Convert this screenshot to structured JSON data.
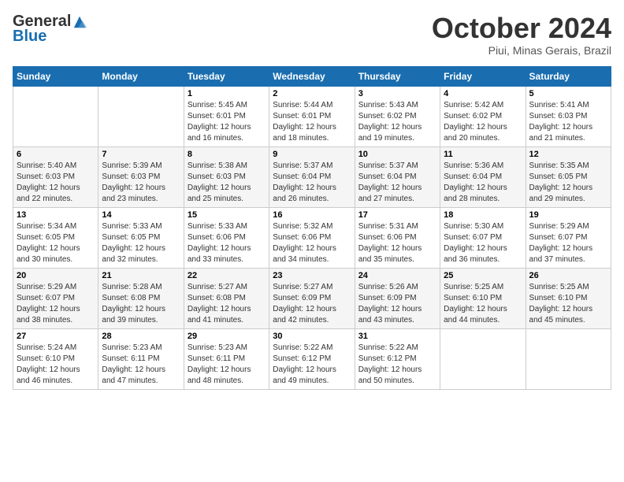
{
  "logo": {
    "general": "General",
    "blue": "Blue"
  },
  "title": "October 2024",
  "location": "Piui, Minas Gerais, Brazil",
  "days_header": [
    "Sunday",
    "Monday",
    "Tuesday",
    "Wednesday",
    "Thursday",
    "Friday",
    "Saturday"
  ],
  "weeks": [
    [
      {
        "day": "",
        "info": ""
      },
      {
        "day": "",
        "info": ""
      },
      {
        "day": "1",
        "info": "Sunrise: 5:45 AM\nSunset: 6:01 PM\nDaylight: 12 hours and 16 minutes."
      },
      {
        "day": "2",
        "info": "Sunrise: 5:44 AM\nSunset: 6:01 PM\nDaylight: 12 hours and 18 minutes."
      },
      {
        "day": "3",
        "info": "Sunrise: 5:43 AM\nSunset: 6:02 PM\nDaylight: 12 hours and 19 minutes."
      },
      {
        "day": "4",
        "info": "Sunrise: 5:42 AM\nSunset: 6:02 PM\nDaylight: 12 hours and 20 minutes."
      },
      {
        "day": "5",
        "info": "Sunrise: 5:41 AM\nSunset: 6:03 PM\nDaylight: 12 hours and 21 minutes."
      }
    ],
    [
      {
        "day": "6",
        "info": "Sunrise: 5:40 AM\nSunset: 6:03 PM\nDaylight: 12 hours and 22 minutes."
      },
      {
        "day": "7",
        "info": "Sunrise: 5:39 AM\nSunset: 6:03 PM\nDaylight: 12 hours and 23 minutes."
      },
      {
        "day": "8",
        "info": "Sunrise: 5:38 AM\nSunset: 6:03 PM\nDaylight: 12 hours and 25 minutes."
      },
      {
        "day": "9",
        "info": "Sunrise: 5:37 AM\nSunset: 6:04 PM\nDaylight: 12 hours and 26 minutes."
      },
      {
        "day": "10",
        "info": "Sunrise: 5:37 AM\nSunset: 6:04 PM\nDaylight: 12 hours and 27 minutes."
      },
      {
        "day": "11",
        "info": "Sunrise: 5:36 AM\nSunset: 6:04 PM\nDaylight: 12 hours and 28 minutes."
      },
      {
        "day": "12",
        "info": "Sunrise: 5:35 AM\nSunset: 6:05 PM\nDaylight: 12 hours and 29 minutes."
      }
    ],
    [
      {
        "day": "13",
        "info": "Sunrise: 5:34 AM\nSunset: 6:05 PM\nDaylight: 12 hours and 30 minutes."
      },
      {
        "day": "14",
        "info": "Sunrise: 5:33 AM\nSunset: 6:05 PM\nDaylight: 12 hours and 32 minutes."
      },
      {
        "day": "15",
        "info": "Sunrise: 5:33 AM\nSunset: 6:06 PM\nDaylight: 12 hours and 33 minutes."
      },
      {
        "day": "16",
        "info": "Sunrise: 5:32 AM\nSunset: 6:06 PM\nDaylight: 12 hours and 34 minutes."
      },
      {
        "day": "17",
        "info": "Sunrise: 5:31 AM\nSunset: 6:06 PM\nDaylight: 12 hours and 35 minutes."
      },
      {
        "day": "18",
        "info": "Sunrise: 5:30 AM\nSunset: 6:07 PM\nDaylight: 12 hours and 36 minutes."
      },
      {
        "day": "19",
        "info": "Sunrise: 5:29 AM\nSunset: 6:07 PM\nDaylight: 12 hours and 37 minutes."
      }
    ],
    [
      {
        "day": "20",
        "info": "Sunrise: 5:29 AM\nSunset: 6:07 PM\nDaylight: 12 hours and 38 minutes."
      },
      {
        "day": "21",
        "info": "Sunrise: 5:28 AM\nSunset: 6:08 PM\nDaylight: 12 hours and 39 minutes."
      },
      {
        "day": "22",
        "info": "Sunrise: 5:27 AM\nSunset: 6:08 PM\nDaylight: 12 hours and 41 minutes."
      },
      {
        "day": "23",
        "info": "Sunrise: 5:27 AM\nSunset: 6:09 PM\nDaylight: 12 hours and 42 minutes."
      },
      {
        "day": "24",
        "info": "Sunrise: 5:26 AM\nSunset: 6:09 PM\nDaylight: 12 hours and 43 minutes."
      },
      {
        "day": "25",
        "info": "Sunrise: 5:25 AM\nSunset: 6:10 PM\nDaylight: 12 hours and 44 minutes."
      },
      {
        "day": "26",
        "info": "Sunrise: 5:25 AM\nSunset: 6:10 PM\nDaylight: 12 hours and 45 minutes."
      }
    ],
    [
      {
        "day": "27",
        "info": "Sunrise: 5:24 AM\nSunset: 6:10 PM\nDaylight: 12 hours and 46 minutes."
      },
      {
        "day": "28",
        "info": "Sunrise: 5:23 AM\nSunset: 6:11 PM\nDaylight: 12 hours and 47 minutes."
      },
      {
        "day": "29",
        "info": "Sunrise: 5:23 AM\nSunset: 6:11 PM\nDaylight: 12 hours and 48 minutes."
      },
      {
        "day": "30",
        "info": "Sunrise: 5:22 AM\nSunset: 6:12 PM\nDaylight: 12 hours and 49 minutes."
      },
      {
        "day": "31",
        "info": "Sunrise: 5:22 AM\nSunset: 6:12 PM\nDaylight: 12 hours and 50 minutes."
      },
      {
        "day": "",
        "info": ""
      },
      {
        "day": "",
        "info": ""
      }
    ]
  ]
}
